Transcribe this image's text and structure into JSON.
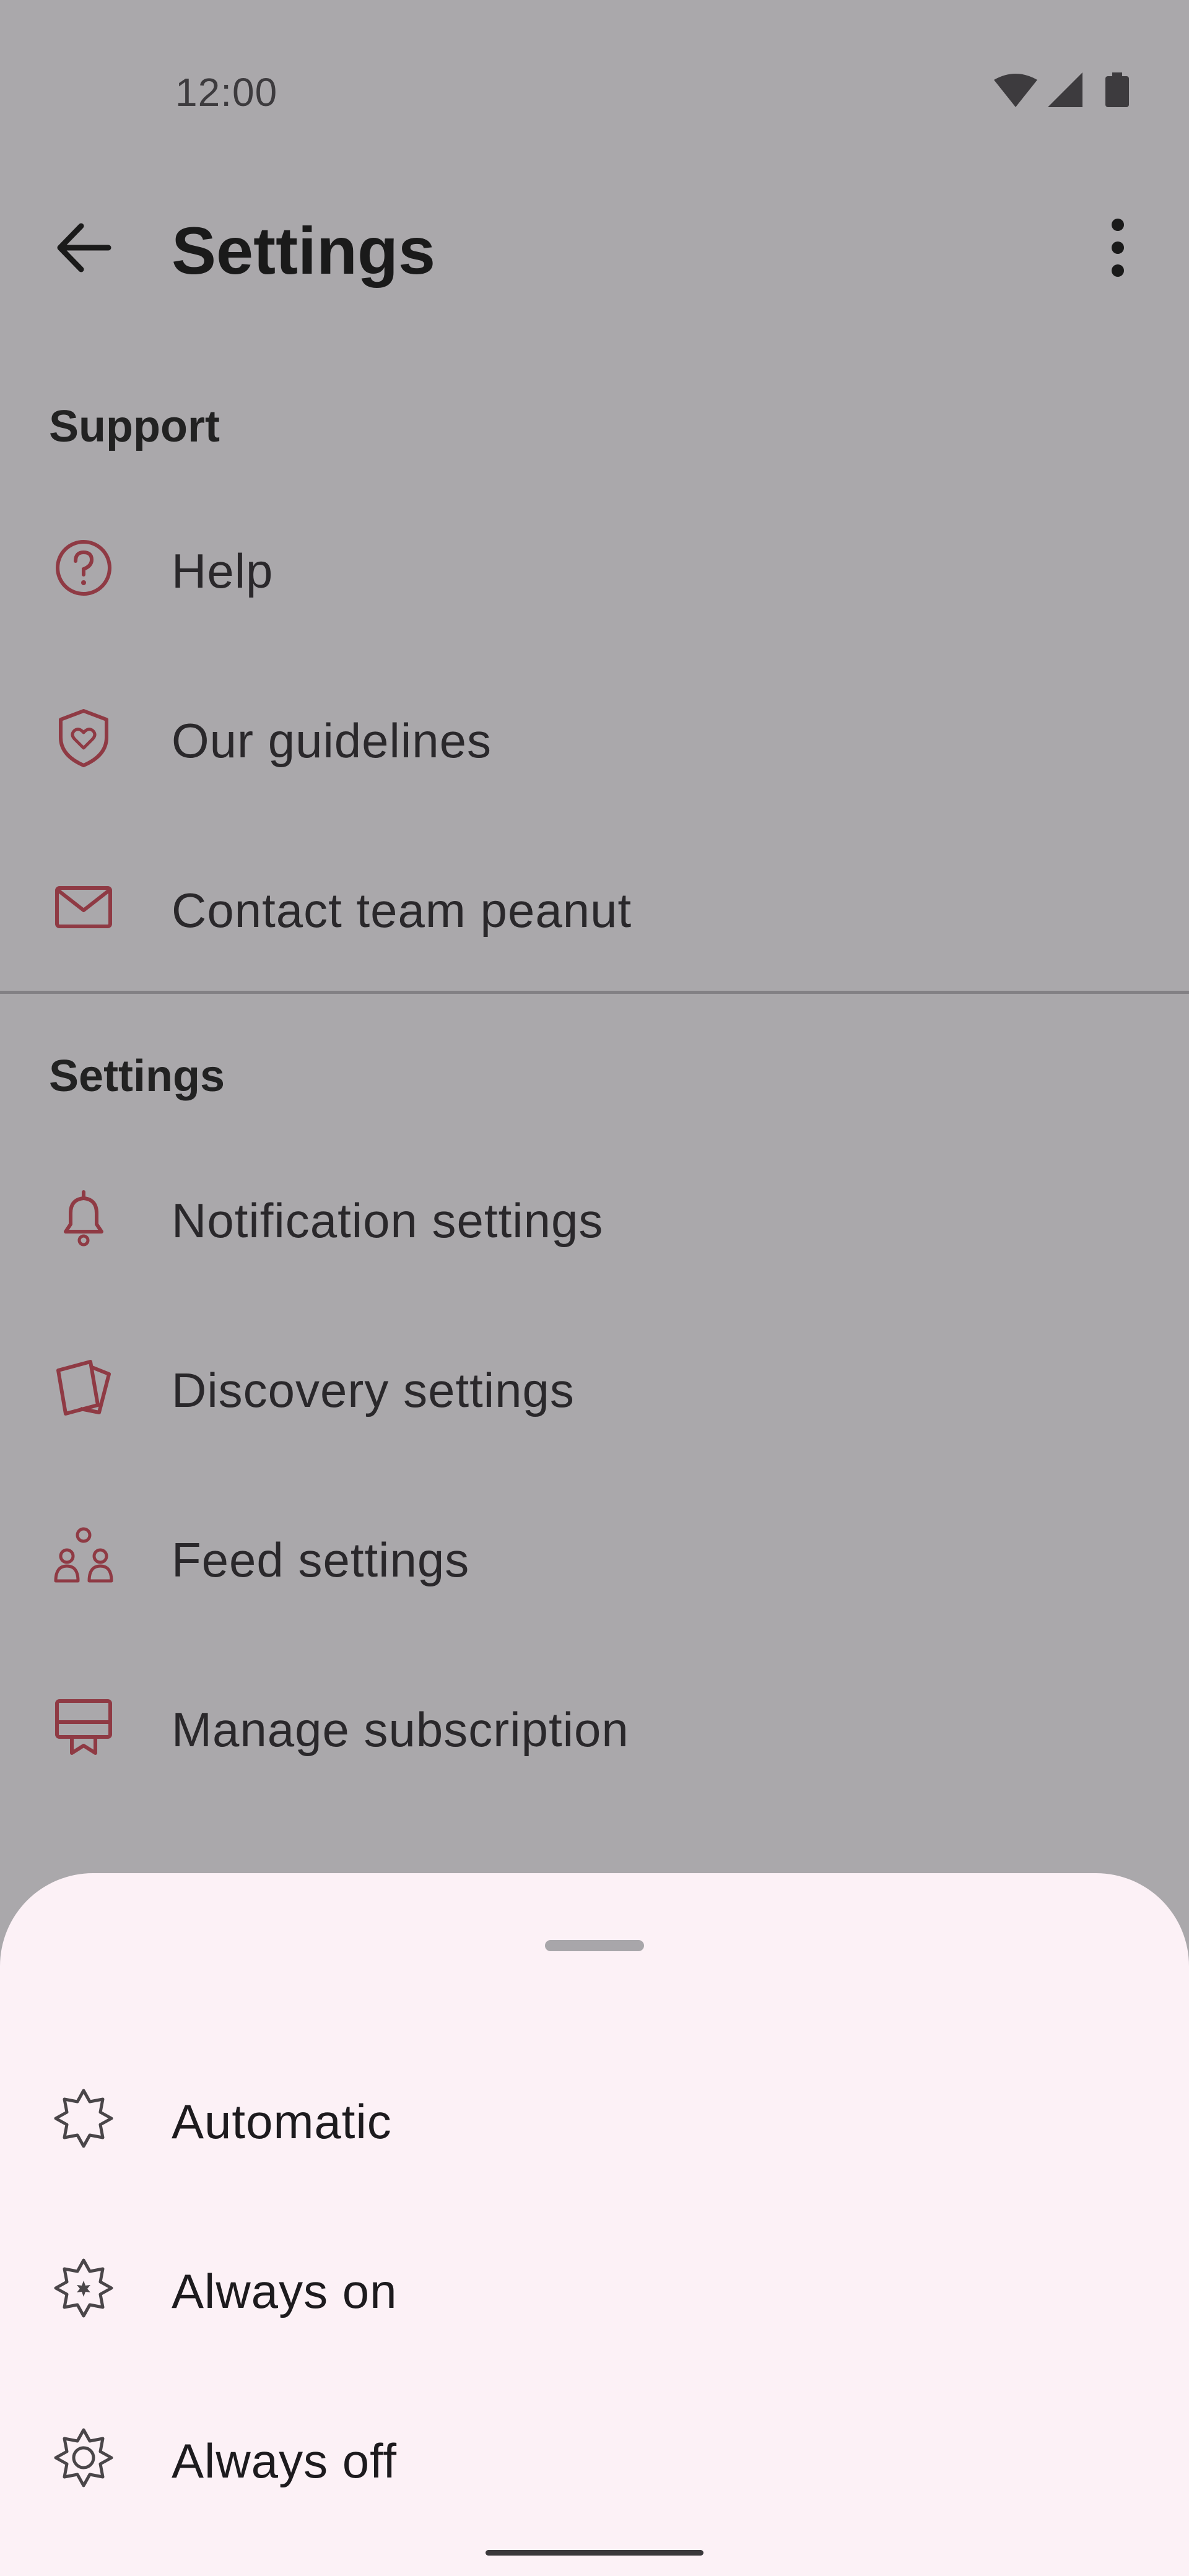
{
  "status_bar": {
    "time": "12:00",
    "icons": [
      "wifi-icon",
      "cellular-signal-icon",
      "battery-icon"
    ]
  },
  "app_bar": {
    "title": "Settings",
    "back_icon": "arrow-back-icon",
    "menu_icon": "more-vert-icon"
  },
  "support_section": {
    "header": "Support",
    "items": [
      {
        "label": "Help",
        "icon": "help-circle-icon"
      },
      {
        "label": "Our guidelines",
        "icon": "shield-heart-icon"
      },
      {
        "label": "Contact team peanut",
        "icon": "mail-icon"
      }
    ]
  },
  "settings_section": {
    "header": "Settings",
    "items": [
      {
        "label": "Notification settings",
        "icon": "bell-icon"
      },
      {
        "label": "Discovery settings",
        "icon": "cards-icon"
      },
      {
        "label": "Feed settings",
        "icon": "people-icon"
      },
      {
        "label": "Manage subscription",
        "icon": "subscription-icon"
      }
    ]
  },
  "bottom_sheet": {
    "options": [
      {
        "label": "Automatic",
        "icon": "badge-outline-icon"
      },
      {
        "label": "Always on",
        "icon": "badge-on-icon"
      },
      {
        "label": "Always off",
        "icon": "badge-off-icon"
      }
    ]
  },
  "colors": {
    "scrim": "#aaa8ab",
    "icon_accent": "#8f3a44",
    "sheet_background": "#fcf1f6",
    "sheet_icon": "#4a4649"
  }
}
